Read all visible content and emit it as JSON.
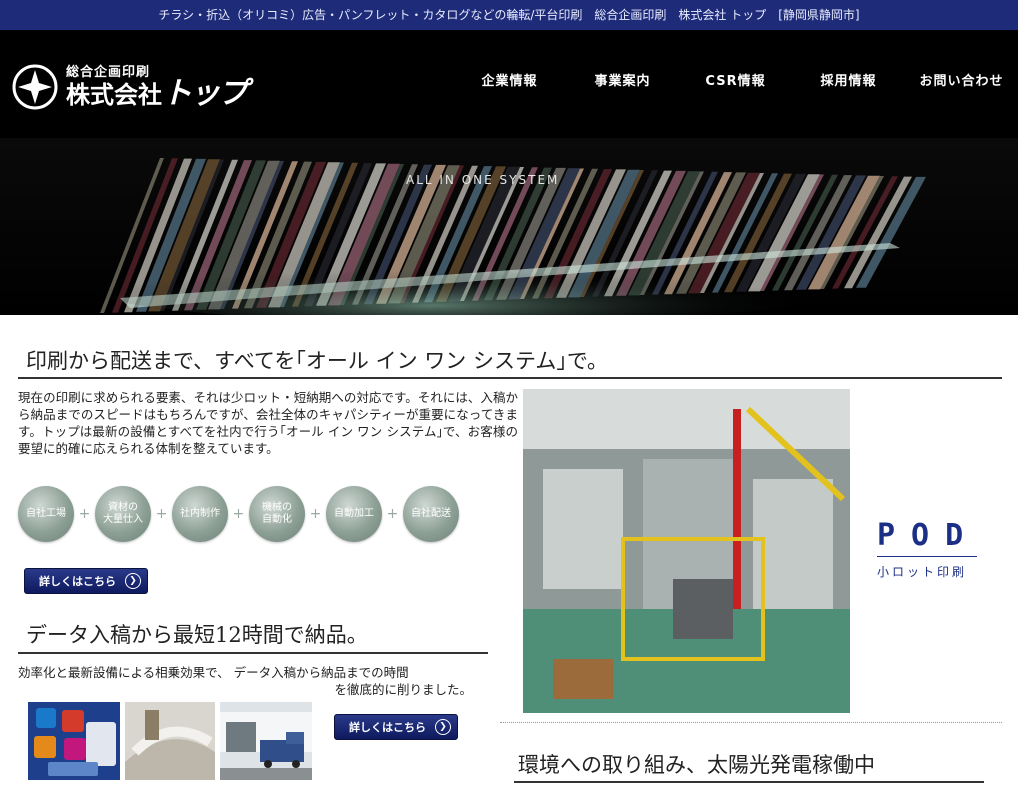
{
  "topbar": {
    "text": "チラシ・折込（オリコミ）広告・パンフレット・カタログなどの輪転/平台印刷　総合企画印刷　株式会社 トップ　[静岡県静岡市]"
  },
  "logo": {
    "sub": "総合企画印刷",
    "main_prefix": "株式会社",
    "main_brand": "トップ"
  },
  "nav": [
    "企業情報",
    "事業案内",
    "CSR情報",
    "採用情報",
    "お問い合わせ"
  ],
  "hero": {
    "caption": "ALL IN ONE SYSTEM"
  },
  "section1": {
    "title": "印刷から配送まで、すべてを｢オール イン ワン システム｣で。",
    "body": "現在の印刷に求められる要素、それは少ロット・短納期への対応です。それには、入稿から納品までのスピードはもちろんですが、会社全体のキャパシティーが重要になってきます。トップは最新の設備とすべてを社内で行う｢オール イン ワン システム｣で、お客様の要望に的確に応えられる体制を整えています。",
    "steps": [
      "自社工場",
      "資材の\n大量仕入",
      "社内制作",
      "機械の\n自動化",
      "自動加工",
      "自社配送"
    ],
    "button": "詳しくはこちら"
  },
  "section2": {
    "title": "データ入稿から最短12時間で納品。",
    "body_line1": "効率化と最新設備による相乗効果で、 データ入稿から納品までの時間",
    "body_line2": "を徹底的に削りました。",
    "button": "詳しくはこちら"
  },
  "pod": {
    "title": "POD",
    "subtitle": "小ロット印刷"
  },
  "section3": {
    "title": "環境への取り組み、太陽光発電稼働中"
  },
  "colors": {
    "navy": "#1e2b78",
    "accent_blue": "#1c2f86",
    "circle": "#8da096"
  }
}
